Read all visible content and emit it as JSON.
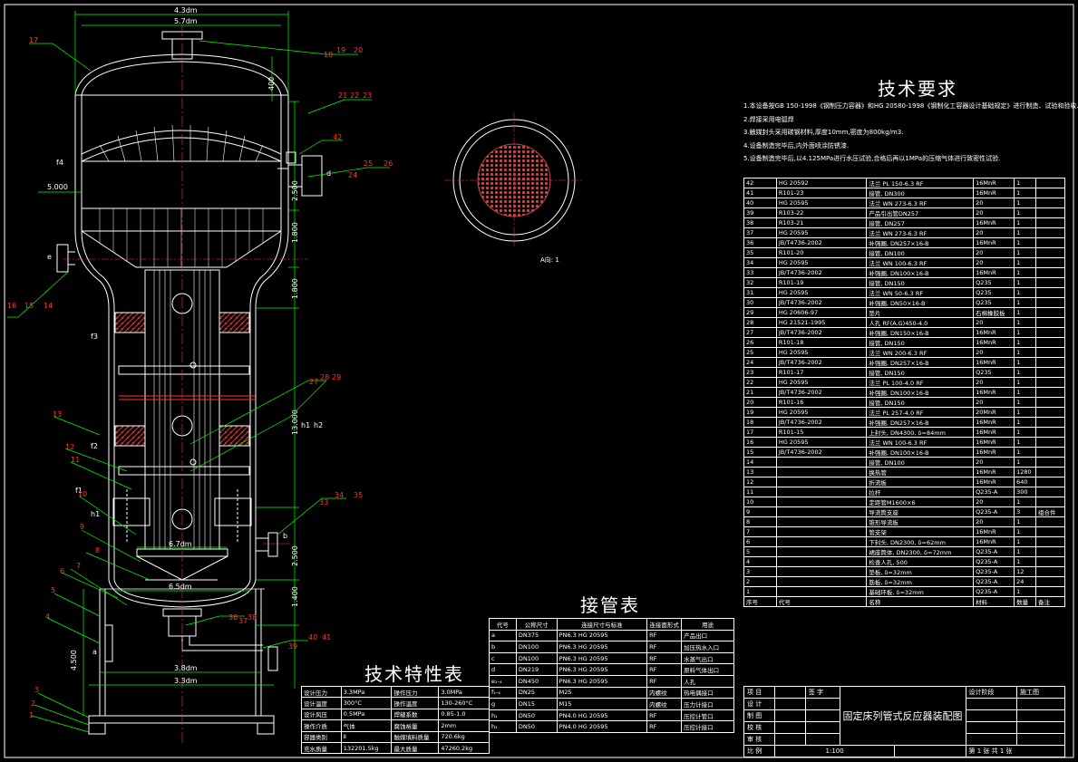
{
  "drawing_title": "固定床列管式反应器装配图",
  "view_label": "A向: 1",
  "tech_requirements": {
    "title": "技术要求",
    "items": [
      "1.本设备按GB 150-1998《钢制压力容器》和HG 20580-1998《钢制化工容器设计基础规定》进行制造、试验和验收.",
      "2.焊接采用电弧焊",
      "3.触媒封头采用碳钢材料,厚度10mm,密度为800kg/m3.",
      "4.设备制造完毕后,内外面喷涂防锈漆.",
      "5.设备制造完毕后,以4.125MPa进行水压试验,合格后再以1MPa的压缩气体进行致密性试验."
    ]
  },
  "nozzle_table": {
    "title": "接管表",
    "headers": [
      "代号",
      "公称尺寸",
      "连接尺寸与标准",
      "连接面形式",
      "用途"
    ],
    "rows": [
      [
        "a",
        "DN375",
        "PN6.3  HG 20595",
        "RF",
        "产品出口"
      ],
      [
        "b",
        "DN100",
        "PN6.3  HG 20595",
        "RF",
        "加压热水入口"
      ],
      [
        "c",
        "DN100",
        "PN6.3  HG 20595",
        "RF",
        "水蒸气出口"
      ],
      [
        "d",
        "DN219",
        "PN6.3  HG 20595",
        "RF",
        "原料气体出口"
      ],
      [
        "e₁-₄",
        "DN450",
        "PN6.3  HG 20595",
        "RF",
        "人孔"
      ],
      [
        "f₁-₄",
        "DN25",
        "M25",
        "内螺纹",
        "热电偶接口"
      ],
      [
        "g",
        "DN15",
        "M15",
        "内螺纹",
        "压力计接口"
      ],
      [
        "h₁",
        "DN50",
        "PN4.0  HG 20595",
        "RF",
        "压控计管口"
      ],
      [
        "h₂",
        "DN50",
        "PN4.0  HG 20595",
        "RF",
        "压控计接口"
      ]
    ]
  },
  "spec_table": {
    "title": "技术特性表",
    "rows": [
      [
        "设计压力",
        "3.3MPa",
        "操作压力",
        "3.0MPa"
      ],
      [
        "设计温度",
        "300°C",
        "操作温度",
        "130-260°C"
      ],
      [
        "设计风压",
        "0.5MPa",
        "焊缝系数",
        "0.85-1.0"
      ],
      [
        "操作介质",
        "气体",
        "腐蚀裕量",
        "2mm"
      ],
      [
        "容器类别",
        "Ⅱ",
        "触媒填料质量",
        "720.6kg"
      ],
      [
        "充水质量",
        "132201.5kg",
        "最大质量",
        "47260.2kg"
      ]
    ]
  },
  "parts_table": {
    "headers": [
      "序号",
      "代号",
      "名称",
      "材料",
      "数量",
      "备注"
    ],
    "rows": [
      [
        "42",
        "HG 20592",
        "法兰 PL 150-6.3 RF",
        "16MnR",
        "1",
        ""
      ],
      [
        "41",
        "R101-23",
        "接管, DN300",
        "16MnR",
        "1",
        ""
      ],
      [
        "40",
        "HG 20595",
        "法兰 WN 273-6.3 RF",
        "20",
        "1",
        ""
      ],
      [
        "39",
        "R103-22",
        "产品引出管DN257",
        "20",
        "1",
        ""
      ],
      [
        "38",
        "R103-21",
        "接管, DN257",
        "16MnR",
        "1",
        ""
      ],
      [
        "37",
        "HG 20595",
        "法兰 WN 273-6.3 RF",
        "20",
        "1",
        ""
      ],
      [
        "36",
        "JB/T4736-2002",
        "补强圈, DN257×16-B",
        "16MnR",
        "1",
        ""
      ],
      [
        "35",
        "R101-20",
        "接管, DN100",
        "20",
        "1",
        ""
      ],
      [
        "34",
        "HG 20595",
        "法兰 WN 100-6.3 RF",
        "20",
        "1",
        ""
      ],
      [
        "33",
        "JB/T4736-2002",
        "补强圈, DN100×16-B",
        "16MnR",
        "1",
        ""
      ],
      [
        "32",
        "R101-19",
        "接管, DN150",
        "Q235",
        "1",
        ""
      ],
      [
        "31",
        "HG 20595",
        "法兰 WN 50-6.3 RF",
        "Q235",
        "1",
        ""
      ],
      [
        "30",
        "JB/T4736-2002",
        "补强圈, DN50×16-B",
        "Q235",
        "1",
        ""
      ],
      [
        "29",
        "HG 20606-97",
        "垫片",
        "石棉橡胶板",
        "1",
        ""
      ],
      [
        "28",
        "HG 21521-1995",
        "人孔 RF(A.G)450-4.0",
        "20",
        "1",
        ""
      ],
      [
        "27",
        "JB/T4736-2002",
        "补强圈, DN150×16-B",
        "16MnR",
        "1",
        ""
      ],
      [
        "26",
        "R101-18",
        "接管, DN150",
        "16MnR",
        "1",
        ""
      ],
      [
        "25",
        "HG 20595",
        "法兰 WN 200-6.3 RF",
        "20",
        "1",
        ""
      ],
      [
        "24",
        "JB/T4736-2002",
        "补强圈, DN257×16-B",
        "16MnR",
        "1",
        ""
      ],
      [
        "23",
        "R101-17",
        "接管, DN150",
        "Q235",
        "1",
        ""
      ],
      [
        "22",
        "HG 20595",
        "法兰 PL 100-4.0 RF",
        "20",
        "1",
        ""
      ],
      [
        "21",
        "JB/T4736-2002",
        "补强圈, DN100×16-B",
        "16MnR",
        "1",
        ""
      ],
      [
        "20",
        "R101-16",
        "接管, DN150",
        "20",
        "1",
        ""
      ],
      [
        "19",
        "HG 20595",
        "法兰 PL 257-4.0 RF",
        "20MnR",
        "1",
        ""
      ],
      [
        "18",
        "JB/T4736-2002",
        "补强圈, DN257×16-B",
        "16MnR",
        "1",
        ""
      ],
      [
        "17",
        "R101-15",
        "上封头, DN4300, δ=84mm",
        "16MnR",
        "1",
        ""
      ],
      [
        "16",
        "HG 20595",
        "法兰 WN 100-6.3 RF",
        "16MnR",
        "1",
        ""
      ],
      [
        "15",
        "JB/T4736-2002",
        "补强圈, DN100×16-B",
        "16MnR",
        "1",
        ""
      ],
      [
        "14",
        "",
        "接管, DN100",
        "20",
        "1",
        ""
      ],
      [
        "13",
        "",
        "换热管",
        "16MnR",
        "1280",
        ""
      ],
      [
        "12",
        "",
        "折流板",
        "16MnR",
        "640",
        ""
      ],
      [
        "11",
        "",
        "拉杆",
        "Q235-A",
        "300",
        ""
      ],
      [
        "10",
        "",
        "定距管M1600×6",
        "20",
        "1",
        ""
      ],
      [
        "9",
        "",
        "导流筒支座",
        "Q235-A",
        "3",
        "组合件"
      ],
      [
        "8",
        "",
        "锥形导流板",
        "20",
        "1",
        ""
      ],
      [
        "7",
        "",
        "管支架",
        "16MnR",
        "1",
        ""
      ],
      [
        "6",
        "",
        "下封头, DN2300, δ=62mm",
        "16MnR",
        "1",
        ""
      ],
      [
        "5",
        "",
        "裙座筒体, DN2300, δ=72mm",
        "Q235-A",
        "1",
        ""
      ],
      [
        "4",
        "",
        "检查人孔, 500",
        "Q235-A",
        "1",
        ""
      ],
      [
        "3",
        "",
        "垫板, δ=32mm",
        "Q235-A",
        "12",
        ""
      ],
      [
        "2",
        "",
        "筋板, δ=32mm",
        "Q235-A",
        "24",
        ""
      ],
      [
        "1",
        "",
        "基础环板, δ=32mm",
        "Q235-A",
        "1",
        ""
      ]
    ]
  },
  "title_block": {
    "item": "项  目",
    "sign": "签  字",
    "design": "设  计",
    "draw": "制  图",
    "check": "校  核",
    "approve": "审  核",
    "stage_label": "设计阶段",
    "stage_value": "施工图",
    "scale_label": "比  例",
    "scale_value": "1:100",
    "sheet": "第 1 张    共 1 张"
  },
  "dimensions": {
    "top_width": "4.3dm",
    "head_height": "400",
    "dim_a": "2.500",
    "dim_b": "1.800",
    "dim_c": "1.800",
    "tube_len": "13.000",
    "dim_d": "2.500",
    "dim_e": "1.400",
    "skirt_h": "4.500",
    "base_w": "3.8dm",
    "base_w2": "3.3dm",
    "inner_w": "5.7dm",
    "lower_w": "6.5dm",
    "left_dim": "5.000"
  },
  "nozzle_labels": [
    "f4",
    "e",
    "f3",
    "f2",
    "f1",
    "h1",
    "b",
    "a",
    "c",
    "d",
    "g",
    "h1",
    "h2"
  ],
  "balloons": [
    {
      "n": "17"
    },
    {
      "n": "18"
    },
    {
      "n": "19"
    },
    {
      "n": "20"
    },
    {
      "n": "21"
    },
    {
      "n": "22"
    },
    {
      "n": "23"
    },
    {
      "n": "42"
    },
    {
      "n": "24"
    },
    {
      "n": "25"
    },
    {
      "n": "26"
    },
    {
      "n": "16"
    },
    {
      "n": "15"
    },
    {
      "n": "14"
    },
    {
      "n": "27"
    },
    {
      "n": "28"
    },
    {
      "n": "29"
    },
    {
      "n": "13"
    },
    {
      "n": "12"
    },
    {
      "n": "11"
    },
    {
      "n": "10"
    },
    {
      "n": "33"
    },
    {
      "n": "34"
    },
    {
      "n": "35"
    },
    {
      "n": "9"
    },
    {
      "n": "8"
    },
    {
      "n": "7"
    },
    {
      "n": "6"
    },
    {
      "n": "5"
    },
    {
      "n": "4"
    },
    {
      "n": "3"
    },
    {
      "n": "2"
    },
    {
      "n": "1"
    },
    {
      "n": "36"
    },
    {
      "n": "37"
    },
    {
      "n": "38"
    },
    {
      "n": "39"
    },
    {
      "n": "40"
    },
    {
      "n": "41"
    }
  ],
  "colors": {
    "background": "#000000",
    "outline": "#ffffff",
    "dimension": "#00ff00",
    "leader": "#00ff00",
    "balloon_text": "#ff3333",
    "centerline": "#ff3333",
    "catalyst": "#b03030",
    "label_yellow": "#ffff00"
  }
}
